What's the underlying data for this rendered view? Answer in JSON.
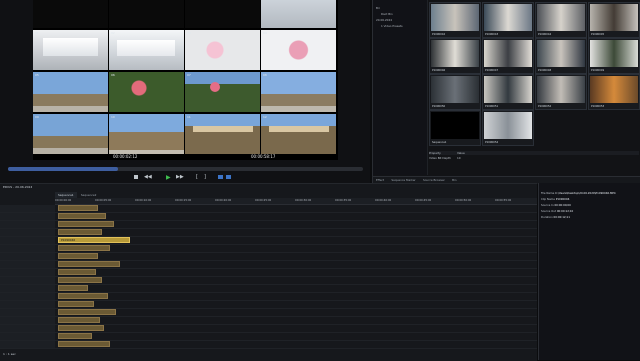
{
  "player": {
    "timecode_left": "00:00:02:12",
    "timecode_right": "00:00:58:17",
    "grid": [
      {
        "n": "01",
        "label": "P1090001"
      },
      {
        "n": "02",
        "label": "P1090002"
      },
      {
        "n": "03",
        "label": "P1090003"
      },
      {
        "n": "04",
        "label": "P1090004"
      },
      {
        "n": "05",
        "label": "P1090005"
      },
      {
        "n": "06",
        "label": "P1090006"
      },
      {
        "n": "07",
        "label": "P1090007"
      },
      {
        "n": "08",
        "label": "P1090008"
      },
      {
        "n": "09",
        "label": "P1090009"
      },
      {
        "n": "10",
        "label": "P1090010"
      },
      {
        "n": "11",
        "label": "P1090011"
      },
      {
        "n": "12",
        "label": "P1090012"
      }
    ]
  },
  "explorer": {
    "tree": [
      "Bin",
      "Root Bin",
      "20.06.2024",
      "1 Video Presets"
    ],
    "tiles": [
      "P1090042",
      "P1090043",
      "P1090044",
      "P1090045",
      "P1090046",
      "P1090047",
      "P1090048",
      "P1090049",
      "P1090050",
      "P1090051",
      "P1090052",
      "P1090053",
      "Sequence1",
      "P1090054"
    ],
    "props": [
      {
        "k": "Property",
        "v": "Value"
      },
      {
        "k": "Video Bit Depth",
        "v": "10"
      }
    ],
    "tabs": [
      "Effect",
      "Sequence Marker",
      "Source Browser",
      "Bin"
    ]
  },
  "timeline": {
    "title": "EDIUS  -  20.06.2024",
    "tabs": [
      "Sequence1",
      "Sequence2"
    ],
    "ruler": [
      "00:00:00:00",
      "00:00:05:00",
      "00:00:10:00",
      "00:00:15:00",
      "00:00:20:00",
      "00:00:25:00",
      "00:00:30:00",
      "00:00:35:00",
      "00:00:40:00",
      "00:00:45:00",
      "00:00:50:00",
      "00:00:55:00"
    ],
    "selected_clip_label": "P1090046",
    "zoom": "1 : 1 sec",
    "inspector": [
      {
        "k": "File Name",
        "v": "C:\\Users\\Desktop\\20.06.2024\\P1090046.MP4"
      },
      {
        "k": "Clip Name",
        "v": "P1090046"
      },
      {
        "k": "Source In",
        "v": "00:00:00;00"
      },
      {
        "k": "Source Out",
        "v": "00:00:12;10"
      },
      {
        "k": "Duration",
        "v": "00:00:12;11"
      }
    ]
  }
}
